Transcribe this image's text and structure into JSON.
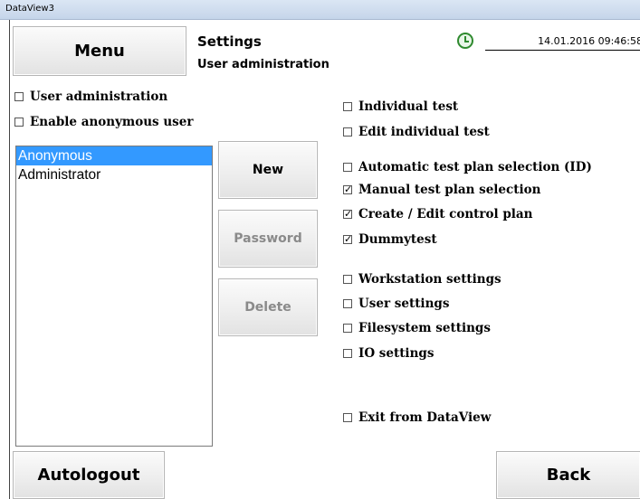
{
  "window": {
    "title": "DataView3"
  },
  "header": {
    "menu_label": "Menu",
    "title": "Settings",
    "subtitle": "User administration",
    "datetime": "14.01.2016   09:46:58",
    "clock_icon": "clock-icon"
  },
  "left_options": {
    "user_administration": {
      "label": "User administration",
      "checked": false
    },
    "enable_anonymous": {
      "label": "Enable anonymous user",
      "checked": false
    }
  },
  "users": {
    "items": [
      "Anonymous",
      "Administrator"
    ],
    "selected": "Anonymous"
  },
  "actions": {
    "new_label": "New",
    "password_label": "Password",
    "delete_label": "Delete"
  },
  "permissions": {
    "individual_test": {
      "label": "Individual test",
      "checked": false
    },
    "edit_individual_test": {
      "label": "Edit individual test",
      "checked": false
    },
    "auto_plan_selection": {
      "label": "Automatic test plan selection (ID)",
      "checked": false
    },
    "manual_plan_selection": {
      "label": "Manual test plan selection",
      "checked": true
    },
    "create_edit_control_plan": {
      "label": "Create / Edit control plan",
      "checked": true
    },
    "dummytest": {
      "label": "Dummytest",
      "checked": true
    },
    "workstation_settings": {
      "label": "Workstation settings",
      "checked": false
    },
    "user_settings": {
      "label": "User settings",
      "checked": false
    },
    "filesystem_settings": {
      "label": "Filesystem settings",
      "checked": false
    },
    "io_settings": {
      "label": "IO settings",
      "checked": false
    },
    "exit_dataview": {
      "label": "Exit from DataView",
      "checked": false
    }
  },
  "footer": {
    "autologout_label": "Autologout",
    "back_label": "Back"
  },
  "colors": {
    "selection": "#3399ff",
    "clock": "#2f8a2f"
  }
}
